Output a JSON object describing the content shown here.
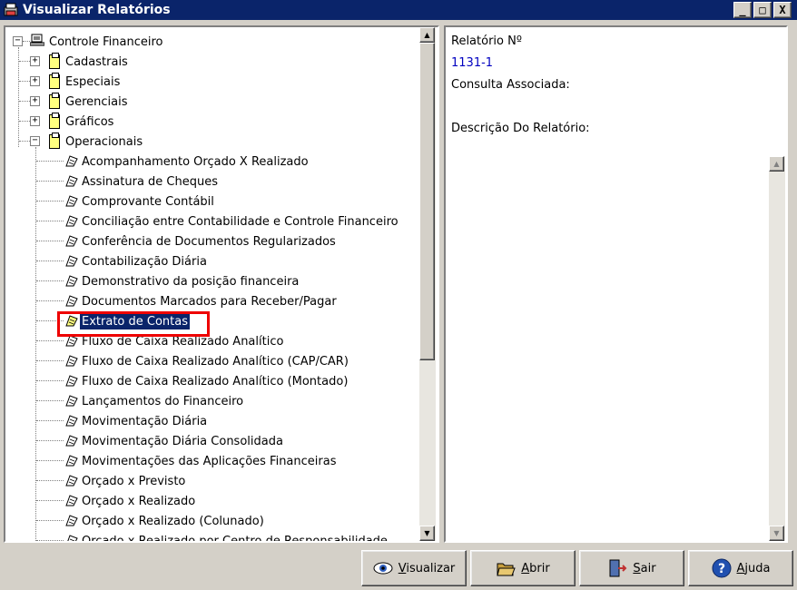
{
  "window": {
    "title": "Visualizar Relatórios",
    "controls": {
      "minimize": "_",
      "maximize": "□",
      "close": "X"
    }
  },
  "tree": {
    "root": "Controle Financeiro",
    "groups": [
      "Cadastrais",
      "Especiais",
      "Gerenciais",
      "Gráficos",
      "Operacionais"
    ],
    "operacionais_items": [
      "Acompanhamento Orçado X Realizado",
      "Assinatura de Cheques",
      "Comprovante Contábil",
      "Conciliação entre Contabilidade e Controle Financeiro",
      "Conferência de Documentos Regularizados",
      "Contabilização Diária",
      "Demonstrativo da posição financeira",
      "Documentos Marcados para Receber/Pagar",
      "Extrato de Contas",
      "Fluxo de Caixa Realizado Analítico",
      "Fluxo de Caixa Realizado Analítico (CAP/CAR)",
      "Fluxo de Caixa Realizado Analítico (Montado)",
      "Lançamentos do Financeiro",
      "Movimentação Diária",
      "Movimentação Diária Consolidada",
      "Movimentações das Aplicações Financeiras",
      "Orçado x Previsto",
      "Orçado x Realizado",
      "Orçado x Realizado (Colunado)",
      "Orçado x Realizado por Centro de Responsabilidade"
    ],
    "selected": "Extrato de Contas"
  },
  "info": {
    "report_number_label": "Relatório Nº",
    "report_number_value": "1131-1",
    "query_label": "Consulta Associada:",
    "description_label": "Descrição Do Relatório:"
  },
  "buttons": {
    "visualizar": "Visualizar",
    "abrir": "Abrir",
    "sair": "Sair",
    "ajuda": "Ajuda"
  },
  "colors": {
    "titlebar": "#0a246a",
    "selection": "#0a246a",
    "highlight_border": "#e00000",
    "report_number": "#0000c0"
  }
}
